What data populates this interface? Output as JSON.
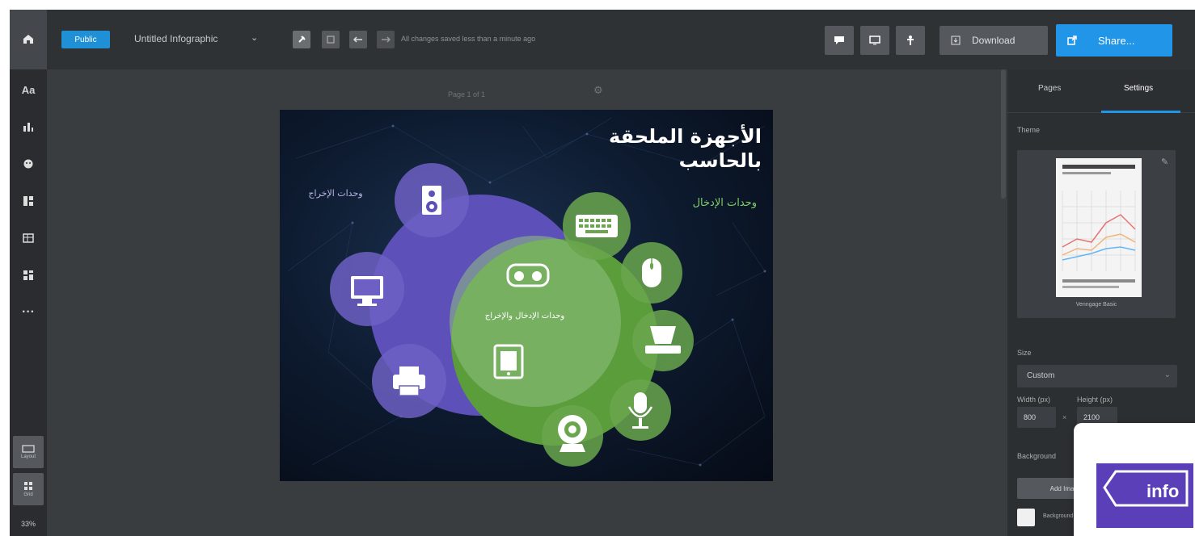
{
  "topbar": {
    "badge": "Public",
    "doc_title": "Untitled Infographic",
    "doc_caret": "⌄",
    "saved_text": "All changes saved less than a minute ago",
    "download_label": "Download",
    "share_label": "Share..."
  },
  "canvas": {
    "page_label": "Page 1 of 1"
  },
  "infographic": {
    "title_line1": "الأجهزة الملحقة",
    "title_line2": "بالحاسب",
    "input_label": "وحدات الإدخال",
    "output_label": "وحدات الإخراج",
    "both_label": "وحدات الإدخال والإخراج",
    "colors": {
      "output": "#5d50b8",
      "input": "#5a9d3a",
      "bg": "#0b1628"
    }
  },
  "sidebar": {
    "zoom": "33%",
    "bottom_label_1": "Layout",
    "bottom_label_2": "Grid"
  },
  "panel": {
    "tab_pages": "Pages",
    "tab_settings": "Settings",
    "theme_header": "Theme",
    "theme_name": "Venngage Basic",
    "size_header": "Size",
    "size_value": "Custom",
    "width_label": "Width (px)",
    "height_label": "Height (px)",
    "width_value": "800",
    "height_value": "2100",
    "times": "×",
    "background_header": "Background",
    "add_image_label": "Add Image",
    "bg_color_label": "Background"
  },
  "overlay": {
    "logo_text": "info"
  }
}
